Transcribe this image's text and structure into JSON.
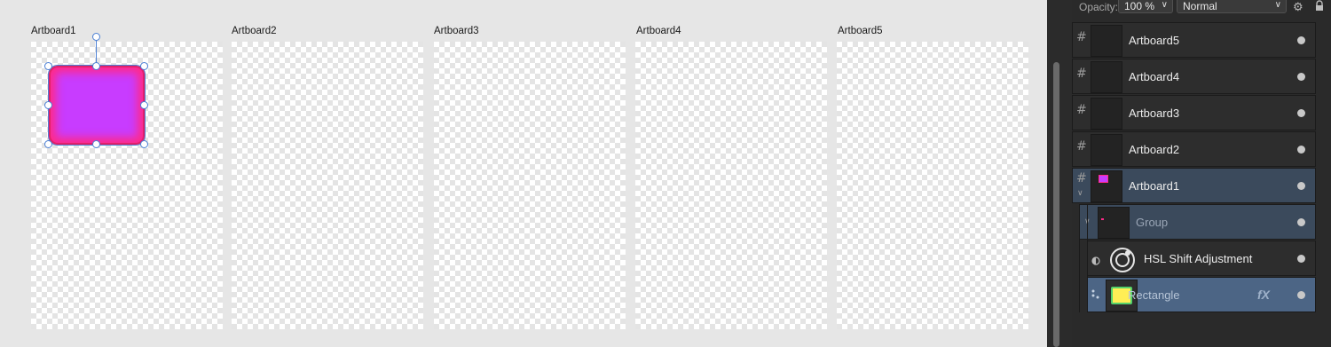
{
  "artboards": [
    {
      "label": "Artboard1"
    },
    {
      "label": "Artboard2"
    },
    {
      "label": "Artboard3"
    },
    {
      "label": "Artboard4"
    },
    {
      "label": "Artboard5"
    }
  ],
  "toolbar": {
    "opacity_label": "Opacity:",
    "opacity_value": "100 %",
    "blend_mode": "Normal",
    "icons": [
      "chevron-down-icon",
      "gear-icon",
      "lock-icon"
    ]
  },
  "layers": [
    {
      "name": "Artboard5",
      "type": "artboard"
    },
    {
      "name": "Artboard4",
      "type": "artboard"
    },
    {
      "name": "Artboard3",
      "type": "artboard"
    },
    {
      "name": "Artboard2",
      "type": "artboard"
    },
    {
      "name": "Artboard1",
      "type": "artboard",
      "expanded": true
    },
    {
      "name": "Group",
      "type": "group",
      "expanded": true
    },
    {
      "name": "HSL Shift Adjustment",
      "type": "adjustment"
    },
    {
      "name": "Rectangle",
      "type": "shape",
      "selected": true,
      "has_fx": true,
      "fx_label": "fX"
    }
  ],
  "colors": {
    "shape_fill": "#c83cff",
    "shape_edge": "#ff2a8a",
    "selection": "#4a7fd4",
    "panel_bg": "#2a2a2a",
    "row_highlight": "#3b4a5c",
    "row_selected": "#4c6585"
  }
}
